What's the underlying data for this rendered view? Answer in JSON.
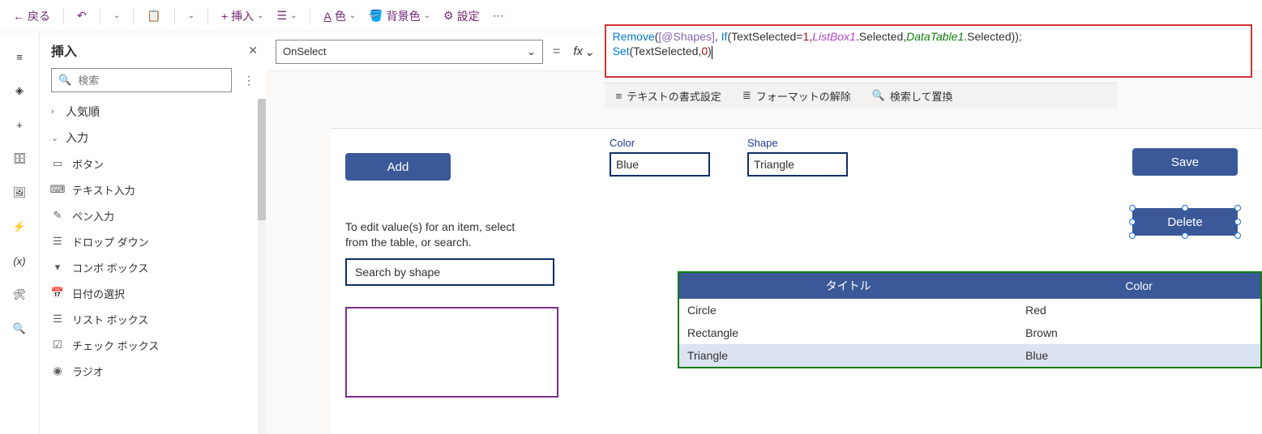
{
  "topbar": {
    "back": "戻る",
    "insert": "挿入",
    "color": "色",
    "bgcolor": "背景色",
    "settings": "設定"
  },
  "formula": {
    "property": "OnSelect",
    "line1_parts": [
      "Remove",
      "(",
      "[@Shapes]",
      ", ",
      "If",
      "(",
      "TextSelected",
      "=",
      "1",
      ",",
      "ListBox1",
      ".",
      "Selected",
      ",",
      "DataTable1",
      ".",
      "Selected",
      "));"
    ],
    "line2_parts": [
      "Set",
      "(",
      "TextSelected",
      ",",
      "0",
      ")"
    ]
  },
  "subbar": {
    "format_text": "テキストの書式設定",
    "remove_format": "フォーマットの解除",
    "find_replace": "検索して置換"
  },
  "panel": {
    "title": "挿入",
    "search_placeholder": "検索",
    "cat_popular": "人気順",
    "cat_input": "入力",
    "items": [
      {
        "icon": "button",
        "label": "ボタン"
      },
      {
        "icon": "text",
        "label": "テキスト入力"
      },
      {
        "icon": "pen",
        "label": "ペン入力"
      },
      {
        "icon": "dropdown",
        "label": "ドロップ ダウン"
      },
      {
        "icon": "combo",
        "label": "コンボ ボックス"
      },
      {
        "icon": "date",
        "label": "日付の選択"
      },
      {
        "icon": "list",
        "label": "リスト ボックス"
      },
      {
        "icon": "check",
        "label": "チェック ボックス"
      },
      {
        "icon": "radio",
        "label": "ラジオ"
      }
    ]
  },
  "canvas": {
    "add_btn": "Add",
    "save_btn": "Save",
    "delete_btn": "Delete",
    "color_label": "Color",
    "shape_label": "Shape",
    "color_value": "Blue",
    "shape_value": "Triangle",
    "info_line1": "To edit value(s) for an item, select",
    "info_line2": "from the table, or search.",
    "search_placeholder": "Search by shape",
    "table": {
      "headers": [
        "タイトル",
        "Color"
      ],
      "rows": [
        {
          "title": "Circle",
          "color": "Red",
          "selected": false
        },
        {
          "title": "Rectangle",
          "color": "Brown",
          "selected": false
        },
        {
          "title": "Triangle",
          "color": "Blue",
          "selected": true
        }
      ]
    }
  }
}
